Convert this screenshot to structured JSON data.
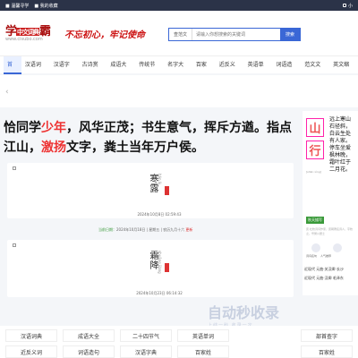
{
  "topbar": {
    "left_items": [
      "■ 温馨寻学",
      "■ 我的收藏"
    ],
    "right_text": "小"
  },
  "logo": {
    "brand_main": "学",
    "brand_badge": "中文词典",
    "brand_end": "霸",
    "url": "www.cisubo.com"
  },
  "slogan": "不忘初心，牢记使命",
  "search": {
    "type": "查范文",
    "placeholder": "请输入你想搜索的关键词",
    "button": "搜索"
  },
  "nav": [
    "首页",
    "汉语词典",
    "汉语字典",
    "古诗赏析",
    "成语大全",
    "传统节气",
    "名字大全",
    "百家姓",
    "近反义词",
    "英语单词",
    "词语造句",
    "范文文库",
    "英文缩写"
  ],
  "poem": {
    "p1": "恰同学",
    "h1": "少年",
    "p2": "，风华正茂；书生意气，挥斥方遒。指点江山，",
    "h2": "激扬",
    "p3": "文字，粪土当年万户侯。"
  },
  "cards": [
    {
      "term": "寒露",
      "pinyin": "hán lù",
      "date": "2024年10月8日 02:59:43"
    },
    {
      "term": "霜降",
      "pinyin": "shuāng jiàng",
      "date": "2024年10月23日 06:14:32"
    }
  ],
  "lunar": {
    "today": "当前日期：",
    "text": "2024年10月18日 | 星期五 | 农历九月十六",
    "link": "更新"
  },
  "side": {
    "big1": "山",
    "big2": "行",
    "pinyin": "[shān xíng]",
    "col": "远上寒山石径斜，白云生处有人家。停车坐爱枫林晚，霜叶红于二月花。",
    "tag": "秋天描写",
    "sub": "唐·杜牧诗词作家，唐朝著名诗人，字牧之，号樊川居士",
    "dlabels": [
      "诗词名句",
      "人气推荐"
    ],
    "links": [
      "近现代  元曲·关汉卿  长沙",
      "近现代  元曲·汉卿  毛泽东"
    ]
  },
  "grid": {
    "row1": [
      "汉语词典",
      "成语大全",
      "二十四节气",
      "英语单词",
      "",
      "部首查字"
    ],
    "row2": [
      "近反义词",
      "词语造句",
      "汉语字典",
      "百家姓",
      "",
      "百家姓"
    ]
  },
  "watermark": {
    "main": "自动秒收录",
    "sub": "上线一秒 收录一次"
  }
}
